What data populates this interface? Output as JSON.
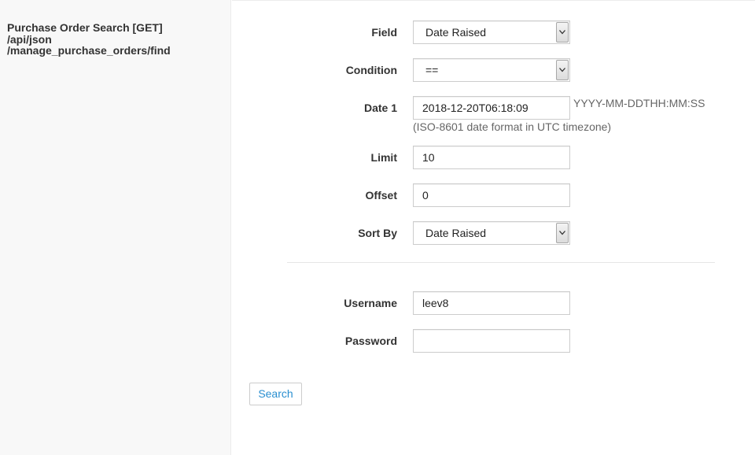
{
  "sidebar": {
    "title_lines": [
      "Purchase Order Search [GET]",
      "/api/json",
      "/manage_purchase_orders/find"
    ]
  },
  "form": {
    "field": {
      "label": "Field",
      "value": "Date Raised"
    },
    "condition": {
      "label": "Condition",
      "value": "=="
    },
    "date1": {
      "label": "Date 1",
      "value": "2018-12-20T06:18:09",
      "format_hint": "YYYY-MM-DDTHH:MM:SS",
      "note": "(ISO-8601 date format in UTC timezone)"
    },
    "limit": {
      "label": "Limit",
      "value": "10"
    },
    "offset": {
      "label": "Offset",
      "value": "0"
    },
    "sort_by": {
      "label": "Sort By",
      "value": "Date Raised"
    },
    "username": {
      "label": "Username",
      "value": "leev8"
    },
    "password": {
      "label": "Password",
      "value": ""
    },
    "search_button": "Search"
  },
  "icons": {
    "select_arrow": "chevron-down-icon"
  },
  "colors": {
    "button_text": "#2a8fd0",
    "sidebar_bg": "#f8f8f8"
  }
}
